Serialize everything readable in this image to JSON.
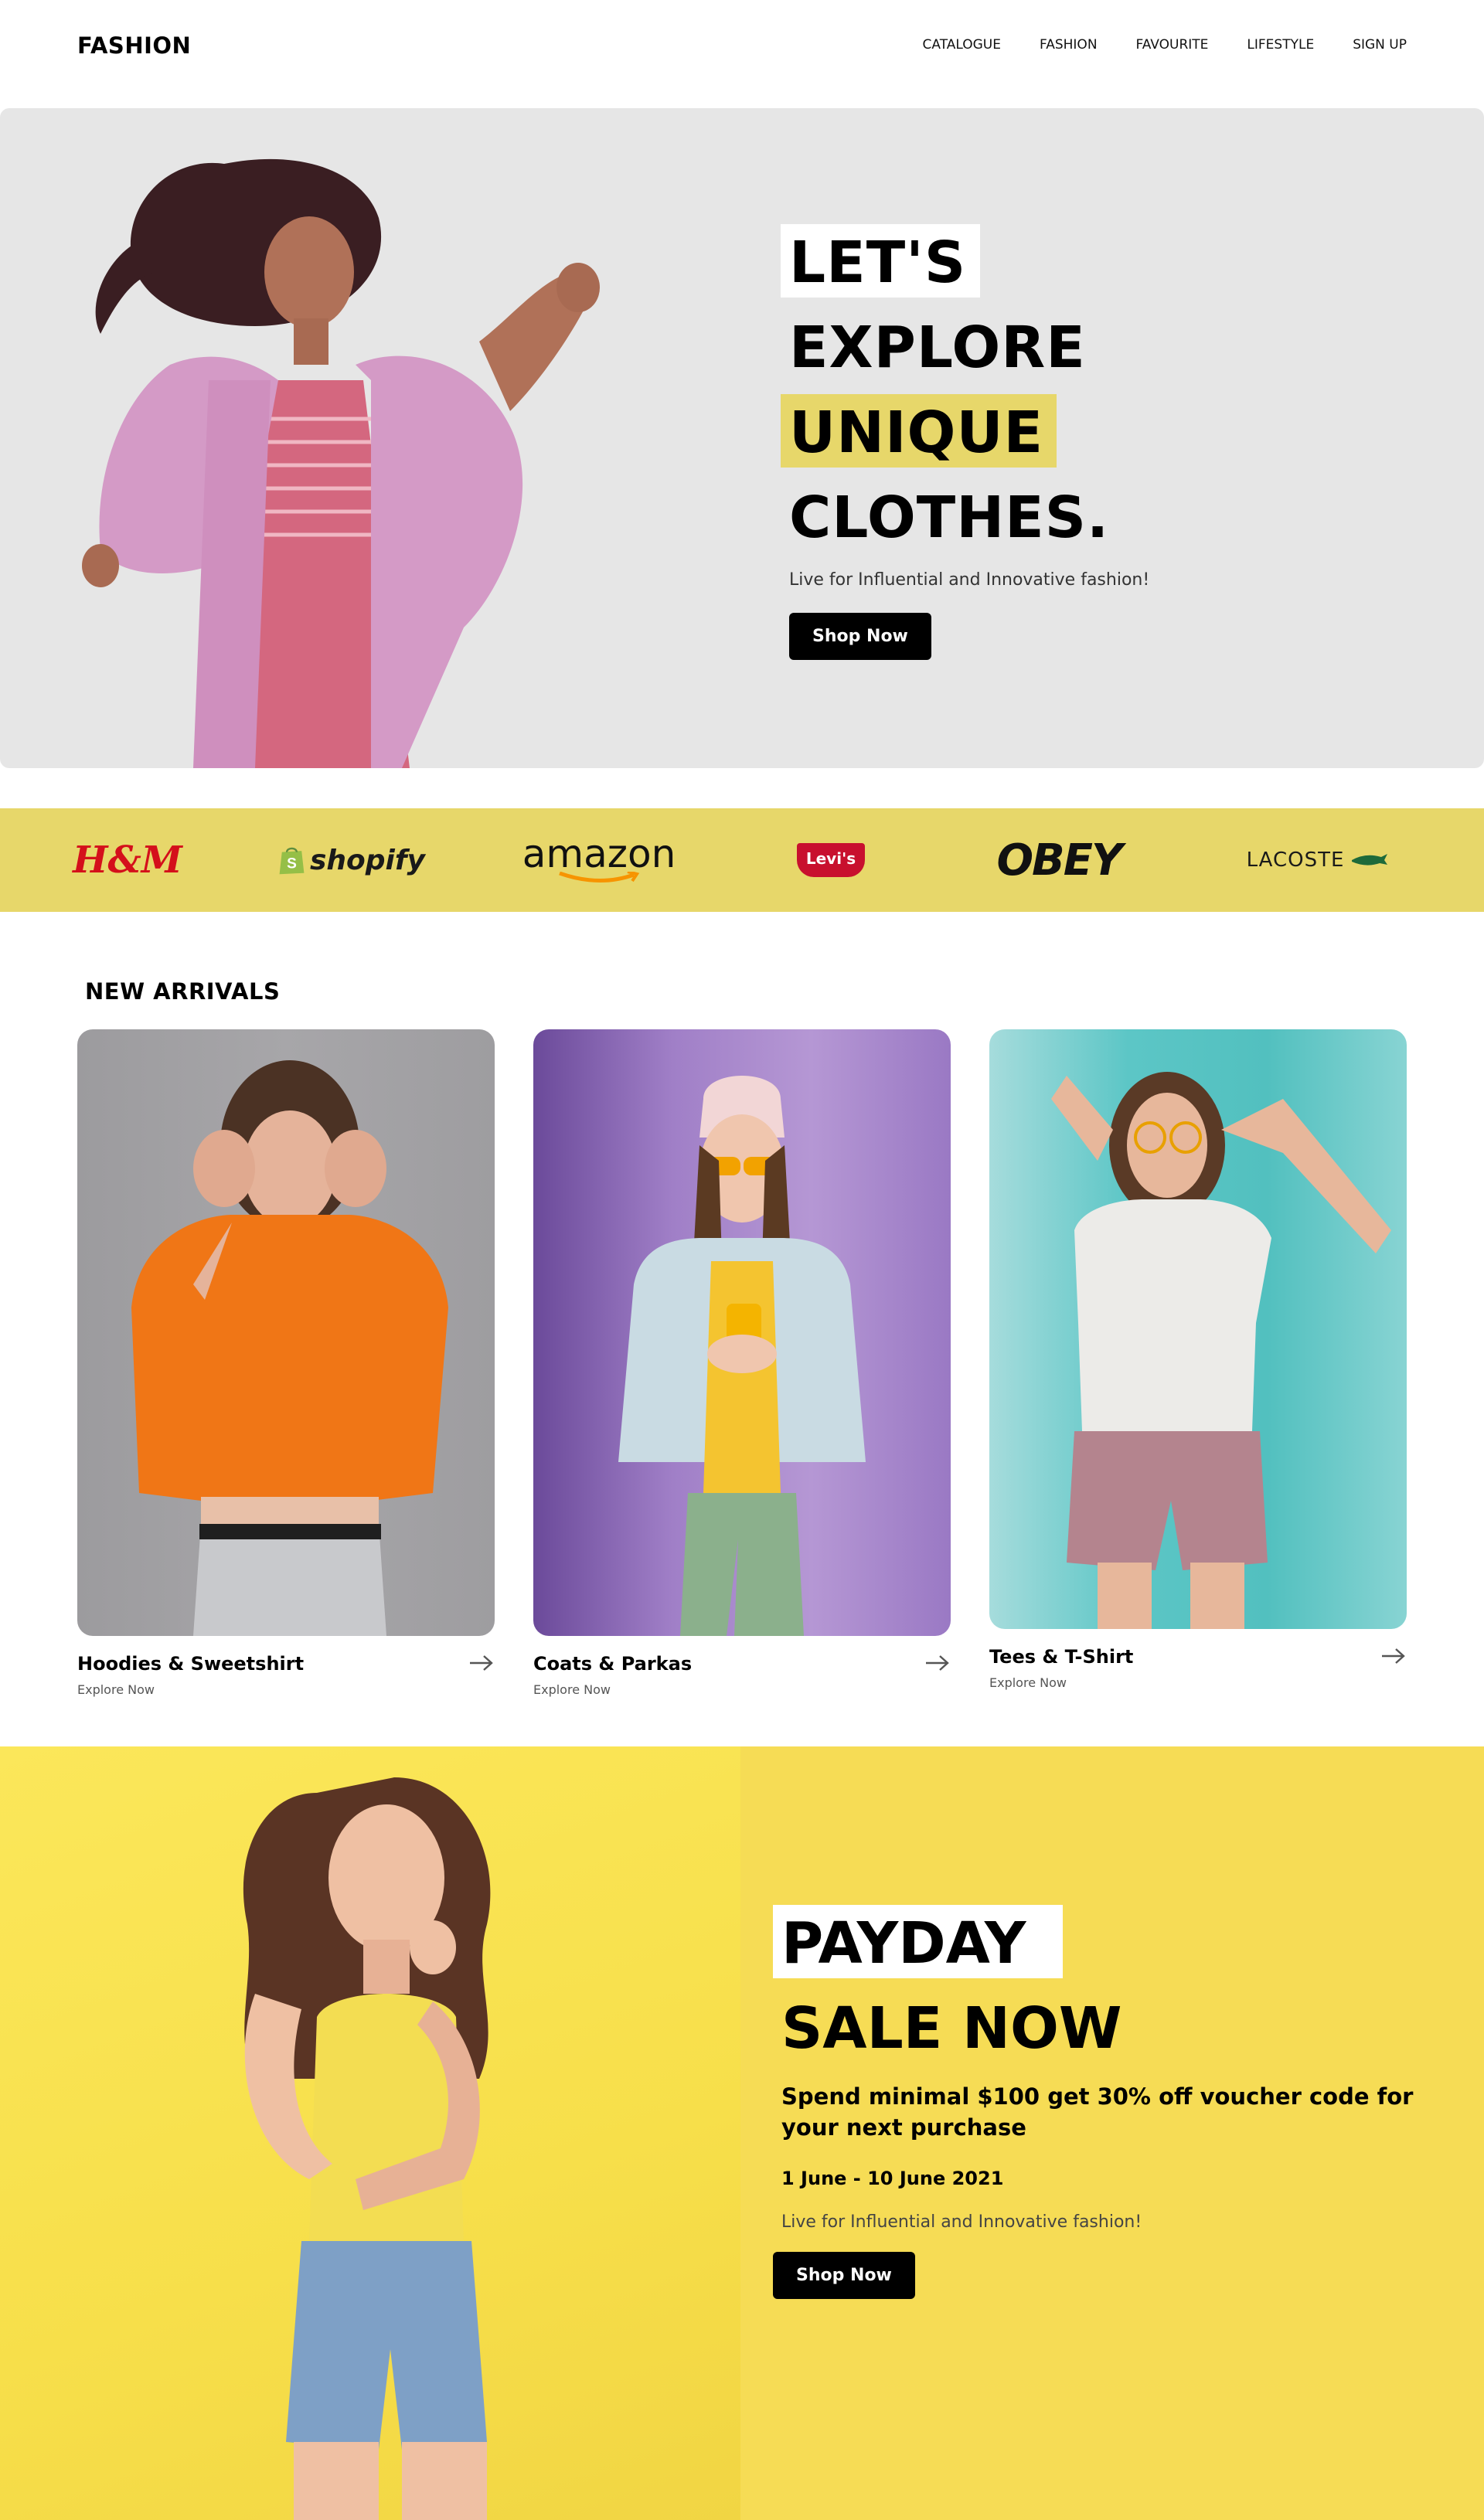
{
  "header": {
    "logo": "FASHION",
    "nav": [
      "CATALOGUE",
      "FASHION",
      "FAVOURITE",
      "LIFESTYLE",
      "SIGN UP"
    ]
  },
  "hero": {
    "lines": [
      "LET'S",
      "EXPLORE",
      "UNIQUE",
      "CLOTHES."
    ],
    "subtitle": "Live for Influential and Innovative fashion!",
    "cta": "Shop Now",
    "colors": {
      "background": "#e6e6e6",
      "highlight": "#e7d76a"
    }
  },
  "brands": {
    "items": [
      "H&M",
      "shopify",
      "amazon",
      "Levi's",
      "OBEY",
      "LACOSTE"
    ],
    "colors": {
      "band": "#e7d76a"
    }
  },
  "new_arrivals": {
    "title": "NEW ARRIVALS",
    "cards": [
      {
        "title": "Hoodies & Sweetshirt",
        "subtitle": "Explore Now"
      },
      {
        "title": "Coats & Parkas",
        "subtitle": "Explore Now"
      },
      {
        "title": "Tees & T-Shirt",
        "subtitle": "Explore Now"
      }
    ]
  },
  "payday": {
    "lines": [
      "PAYDAY",
      "SALE NOW"
    ],
    "promo": "Spend minimal $100 get 30% off voucher code for your next purchase",
    "date": "1 June - 10 June 2021",
    "subtitle": "Live for Influential and Innovative fashion!",
    "cta": "Shop Now",
    "colors": {
      "background": "#f6dc55"
    }
  }
}
